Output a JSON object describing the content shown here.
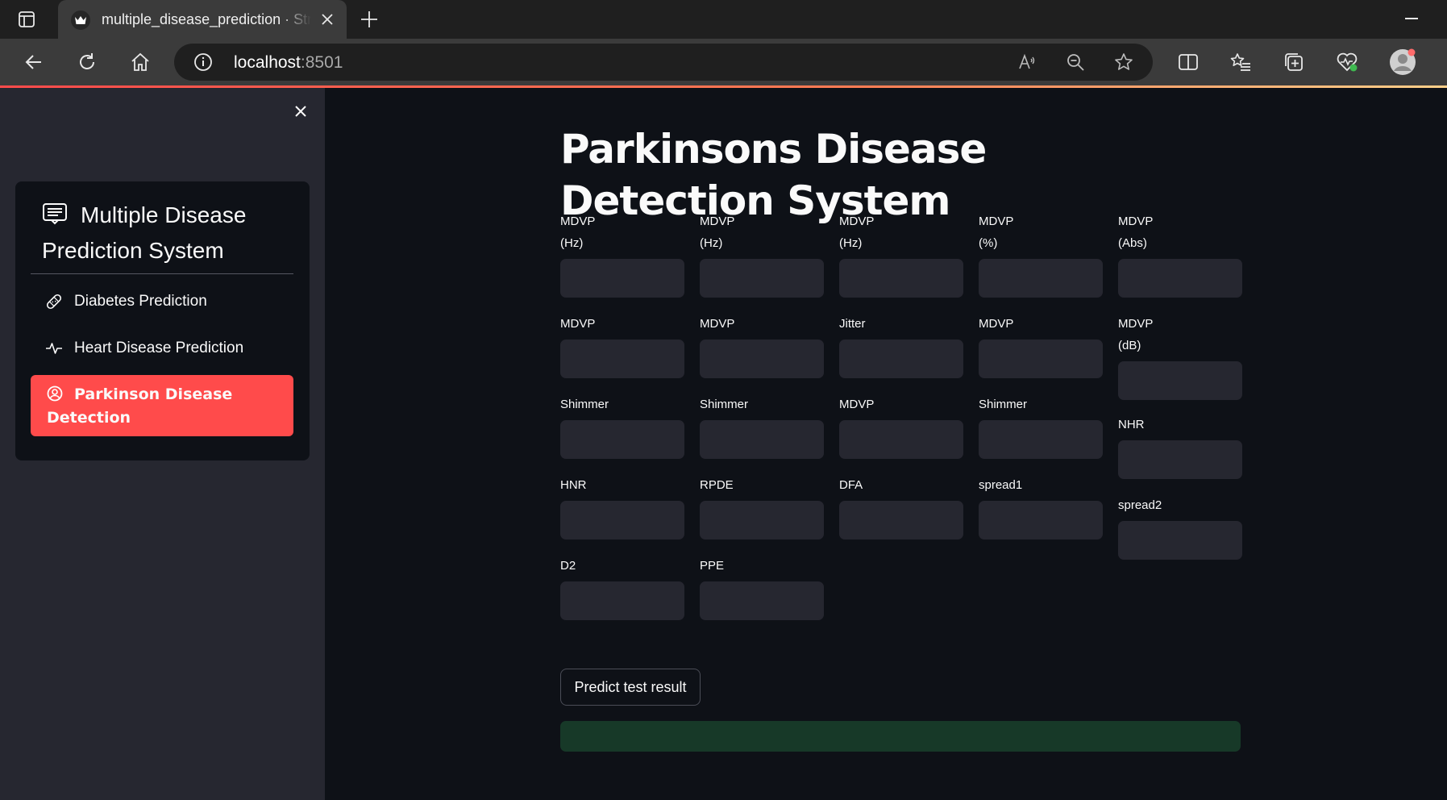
{
  "browser": {
    "tab_title": "multiple_disease_prediction · Streamlit",
    "url_host": "localhost",
    "url_port": ":8501"
  },
  "sidebar": {
    "menu_title": "Multiple Disease Prediction System",
    "items": [
      {
        "label": "Diabetes Prediction",
        "icon": "bandaid-icon",
        "selected": false
      },
      {
        "label": "Heart Disease Prediction",
        "icon": "activity-icon",
        "selected": false
      },
      {
        "label": "Parkinson Disease Detection",
        "icon": "person-circle-icon",
        "selected": true
      }
    ]
  },
  "main": {
    "title": "Parkinsons Disease Detection System",
    "fields": [
      [
        "MDVP (Hz)",
        "MDVP",
        "Shimmer",
        "HNR",
        "D2"
      ],
      [
        "MDVP (Hz)",
        "MDVP",
        "Shimmer",
        "RPDE",
        "PPE"
      ],
      [
        "MDVP (Hz)",
        "Jitter",
        "MDVP",
        "DFA"
      ],
      [
        "MDVP (%)",
        "MDVP",
        "Shimmer",
        "spread1"
      ],
      [
        "MDVP (Abs)",
        "MDVP (dB)",
        "NHR",
        "spread2"
      ]
    ],
    "predict_button": "Predict test result",
    "result_text": ""
  },
  "colors": {
    "accent": "#ff4b4b",
    "background": "#0e1117",
    "sidebar": "#262730",
    "success": "#173928"
  }
}
